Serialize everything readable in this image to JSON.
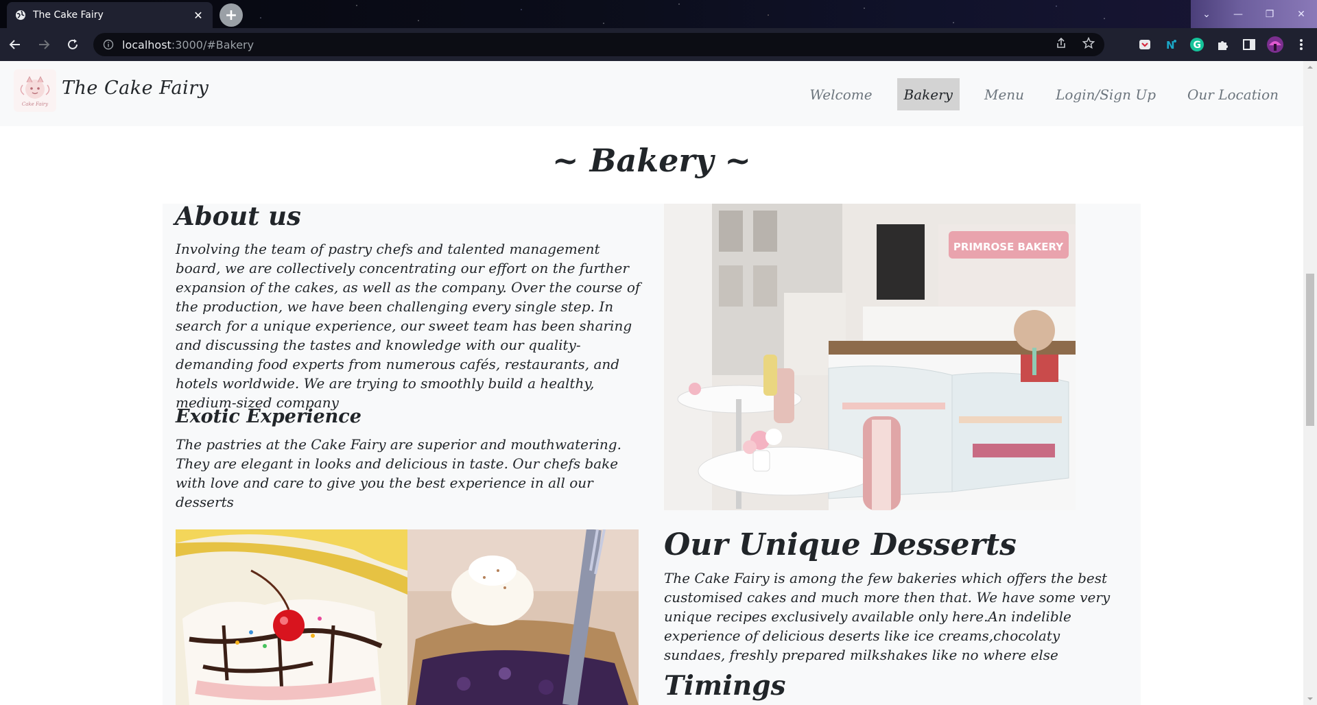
{
  "browser": {
    "tab_title": "The Cake Fairy",
    "url_host": "localhost",
    "url_path": ":3000/#Bakery"
  },
  "site": {
    "brand": "The Cake Fairy",
    "nav": [
      {
        "label": "Welcome",
        "active": false
      },
      {
        "label": "Bakery",
        "active": true
      },
      {
        "label": "Menu",
        "active": false
      },
      {
        "label": "Login/Sign Up",
        "active": false
      },
      {
        "label": "Our Location",
        "active": false
      }
    ]
  },
  "section": {
    "title": "~ Bakery ~",
    "about": {
      "heading": "About us",
      "text": "Involving the team of pastry chefs and talented management board, we are collectively concentrating our effort on the further expansion of the cakes, as well as the company. Over the course of the production, we have been challenging every single step. In search for a unique experience, our sweet team has been sharing and discussing the tastes and knowledge with our quality-demanding food experts from numerous cafés, restaurants, and hotels worldwide. We are trying to smoothly build a healthy, medium-sized company"
    },
    "exotic": {
      "heading": "Exotic Experience",
      "text": "The pastries at the Cake Fairy are superior and mouthwatering. They are elegant in looks and delicious in taste. Our chefs bake with love and care to give you the best experience in all our desserts"
    },
    "unique": {
      "heading": "Our Unique Desserts",
      "text": "The Cake Fairy is among the few bakeries which offers the best customised cakes and much more then that. We have some very unique recipes exclusively available only here.An indelible experience of delicious deserts like ice creams,chocolaty sundaes, freshly prepared milkshakes like no where else"
    },
    "timings": {
      "heading": "Timings"
    }
  },
  "colors": {
    "navbar_bg": "#f8f9fa",
    "active_link_bg": "#d3d3d3",
    "text": "#212529",
    "muted_link": "#6c757d"
  }
}
